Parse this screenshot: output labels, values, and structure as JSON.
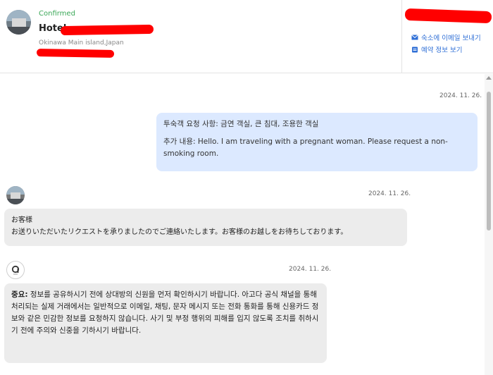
{
  "header": {
    "status": "Confirmed",
    "hotel_name": "Hotel",
    "location": "Okinawa Main island,Japan",
    "actions": [
      {
        "label": "숙소에 이메일 보내기",
        "icon": "mail-icon"
      },
      {
        "label": "예약 정보 보기",
        "icon": "calendar-icon"
      }
    ]
  },
  "chat": {
    "messages": [
      {
        "sender": "user",
        "date": "2024. 11. 26.",
        "request_line": "투숙객 요청 사항: 금연 객실, 큰 침대, 조용한 객실",
        "additional_line": "추가 내용: Hello. I am traveling with a pregnant woman. Please request a non-smoking room."
      },
      {
        "sender": "hotel",
        "date": "2024. 11. 26.",
        "line1": "お客様",
        "line2": "お送りいただいたリクエストを承りましたのでご連絡いたします。お客様のお越しをお待ちしております。"
      },
      {
        "sender": "system",
        "date": "2024. 11. 26.",
        "bold_prefix": "중요:",
        "text": " 정보를 공유하시기 전에 상대방의 신원을 먼저 확인하시기 바랍니다. 아고다 공식 채널을 통해 처리되는 실제 거래에서는 일반적으로 이메일, 채팅, 문자 메시지 또는 전화 통화를 통해 신용카드 정보와 같은 민감한 정보를 요청하지 않습니다. 사기 및 부정 행위의 피해를 입지 않도록 조치를 취하시기 전에 주의와 신중을 기하시기 바랍니다."
      }
    ]
  },
  "colors": {
    "confirmed": "#3aa757",
    "link": "#2f6fd6",
    "user_bubble": "#dce9ff",
    "other_bubble": "#ececec",
    "redaction": "#ff0000"
  }
}
